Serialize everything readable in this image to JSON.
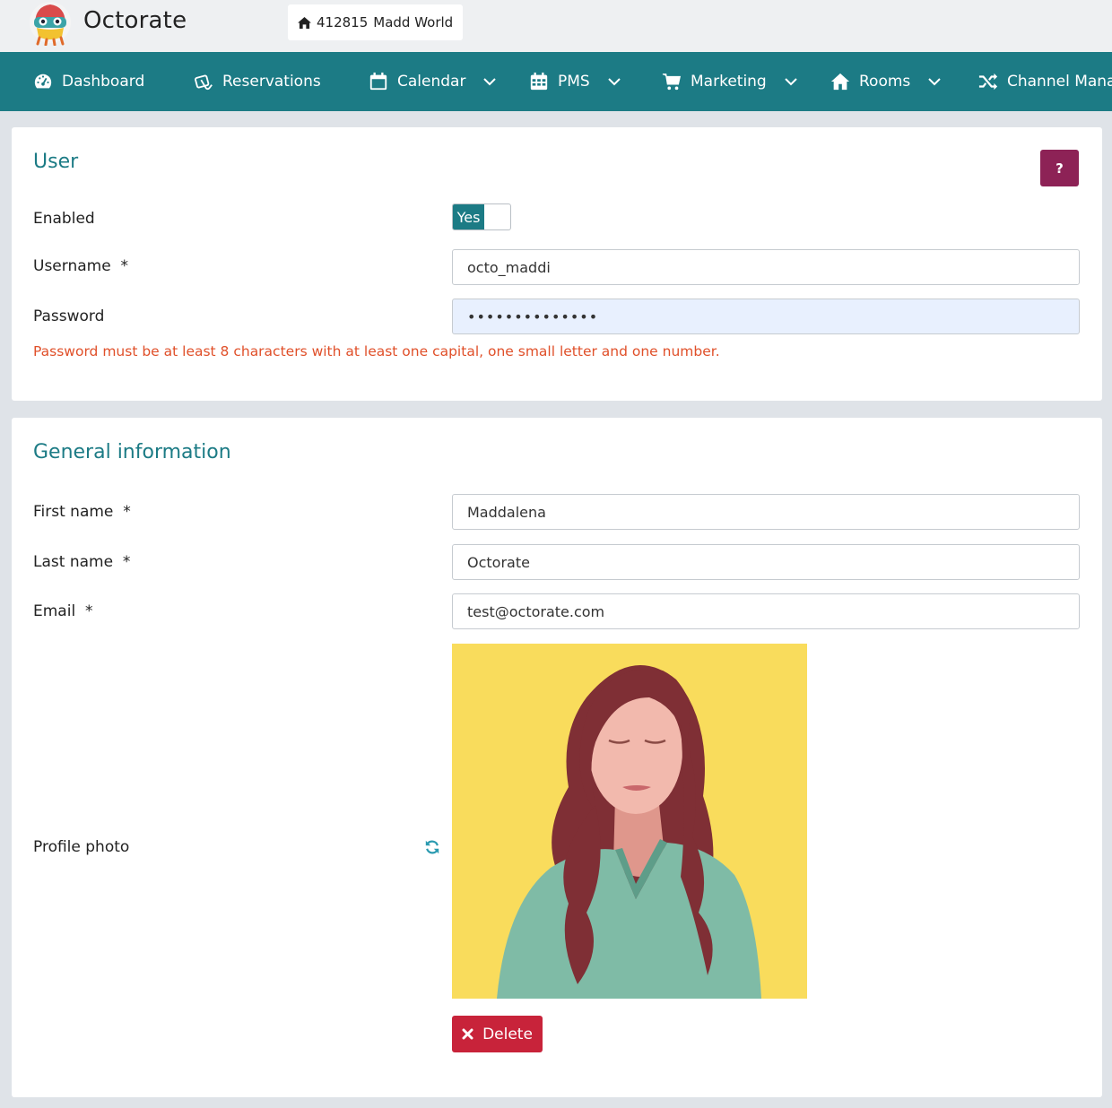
{
  "app": {
    "title": "Octorate"
  },
  "property": {
    "id": "412815",
    "name": "Madd World",
    "icon": "home-icon"
  },
  "nav": {
    "items": [
      {
        "label": "Dashboard",
        "icon": "dashboard-icon"
      },
      {
        "label": "Reservations",
        "icon": "reservations-icon"
      },
      {
        "label": "Calendar",
        "icon": "calendar-icon",
        "dropdown": true
      },
      {
        "label": "PMS",
        "icon": "pms-calendar-icon",
        "dropdown": true
      },
      {
        "label": "Marketing",
        "icon": "cart-icon",
        "dropdown": true
      },
      {
        "label": "Rooms",
        "icon": "home-icon",
        "dropdown": true
      },
      {
        "label": "Channel Manage",
        "icon": "shuffle-icon"
      }
    ]
  },
  "user_section": {
    "title": "User",
    "help_label": "?",
    "enabled_label": "Enabled",
    "enabled_value": "Yes",
    "username_label": "Username  *",
    "username_value": "octo_maddi",
    "password_label": "Password",
    "password_value": "••••••••••••••",
    "password_hint": "Password must be at least 8 characters with at least one capital, one small letter and one number."
  },
  "general_section": {
    "title": "General information",
    "first_name_label": "First name  *",
    "first_name_value": "Maddalena",
    "last_name_label": "Last name  *",
    "last_name_value": "Octorate",
    "email_label": "Email  *",
    "email_value": "test@octorate.com",
    "photo_label": "Profile photo",
    "delete_label": "Delete"
  },
  "colors": {
    "nav_bg": "#1c7b85",
    "accent": "#1c7b85",
    "help_btn": "#8d2256",
    "delete_btn": "#c8233a",
    "warning_text": "#e0502a",
    "photo_bg": "#f9dc5c"
  }
}
